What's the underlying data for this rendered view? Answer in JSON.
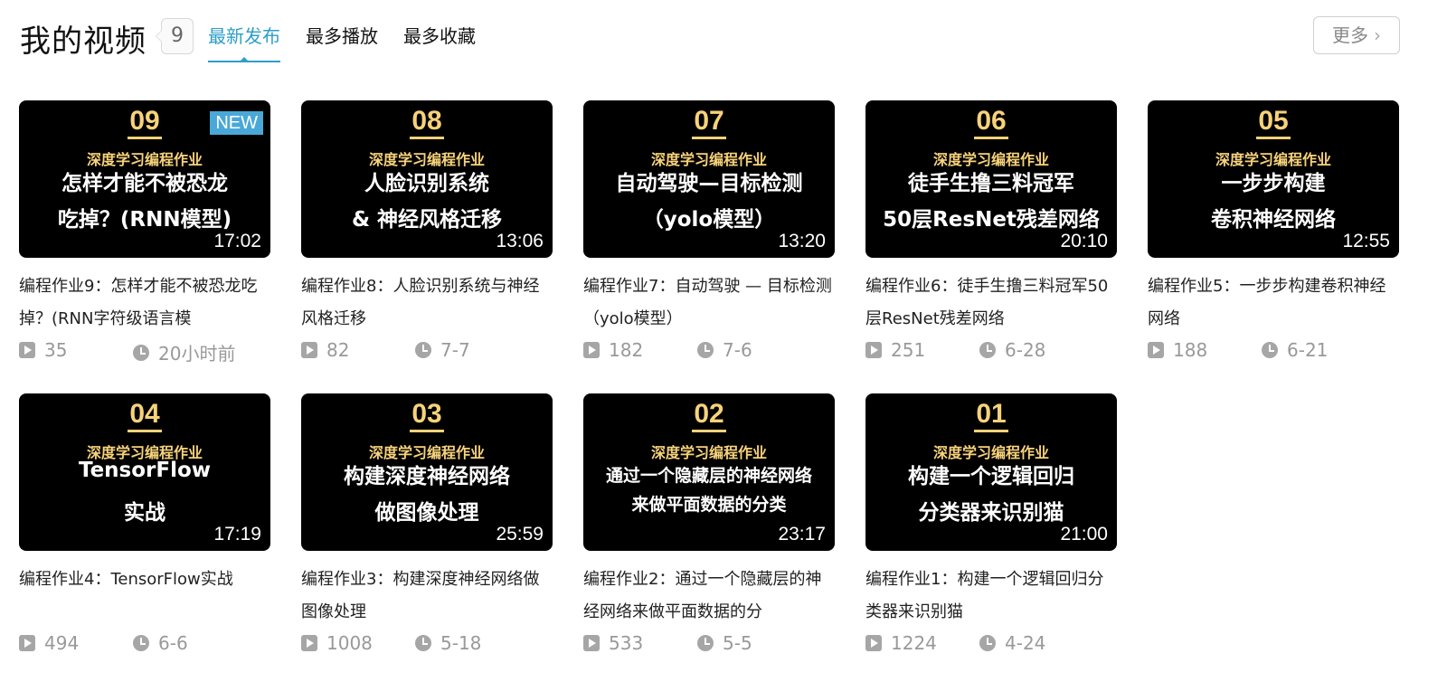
{
  "header": {
    "title": "我的视频",
    "count": "9",
    "tabs": [
      {
        "label": "最新发布"
      },
      {
        "label": "最多播放"
      },
      {
        "label": "最多收藏"
      }
    ],
    "more_label": "更多"
  },
  "icons": {
    "play": "play-icon",
    "clock": "clock-icon",
    "chevron": "chevron-right-icon"
  },
  "colors": {
    "accent": "#2e9ec8",
    "thumb_bg": "#000000",
    "thumb_gold": "#f7d27a",
    "new_badge": "#4aa8d8"
  },
  "videos": [
    {
      "num": "09",
      "category": "深度学习编程作业",
      "lines": [
        "怎样才能不被恐龙",
        "吃掉？(RNN模型)"
      ],
      "duration": "17:02",
      "badge": "NEW",
      "title": "编程作业9：怎样才能不被恐龙吃掉？(RNN字符级语言模",
      "plays": "35",
      "date": "20小时前"
    },
    {
      "num": "08",
      "category": "深度学习编程作业",
      "lines": [
        "人脸识别系统",
        "& 神经风格迁移"
      ],
      "duration": "13:06",
      "title": "编程作业8：人脸识别系统与神经风格迁移",
      "plays": "82",
      "date": "7-7"
    },
    {
      "num": "07",
      "category": "深度学习编程作业",
      "lines": [
        "自动驾驶—目标检测",
        "（yolo模型）"
      ],
      "duration": "13:20",
      "title": "编程作业7：自动驾驶 — 目标检测（yolo模型）",
      "plays": "182",
      "date": "7-6"
    },
    {
      "num": "06",
      "category": "深度学习编程作业",
      "lines": [
        "徒手生撸三料冠军",
        "50层ResNet残差网络"
      ],
      "duration": "20:10",
      "title": "编程作业6：徒手生撸三料冠军50层ResNet残差网络",
      "plays": "251",
      "date": "6-28"
    },
    {
      "num": "05",
      "category": "深度学习编程作业",
      "lines": [
        "一步步构建",
        "卷积神经网络"
      ],
      "duration": "12:55",
      "title": "编程作业5：一步步构建卷积神经网络",
      "plays": "188",
      "date": "6-21"
    },
    {
      "num": "04",
      "category": "深度学习编程作业",
      "lines": [
        "TensorFlow",
        "实战"
      ],
      "duration": "17:19",
      "title": "编程作业4：TensorFlow实战",
      "plays": "494",
      "date": "6-6"
    },
    {
      "num": "03",
      "category": "深度学习编程作业",
      "lines": [
        "构建深度神经网络",
        "做图像处理"
      ],
      "duration": "25:59",
      "title": "编程作业3：构建深度神经网络做图像处理",
      "plays": "1008",
      "date": "5-18"
    },
    {
      "num": "02",
      "category": "深度学习编程作业",
      "lines": [
        "通过一个隐藏层的神经网络",
        "来做平面数据的分类"
      ],
      "duration": "23:17",
      "title": "编程作业2：通过一个隐藏层的神经网络来做平面数据的分",
      "plays": "533",
      "date": "5-5"
    },
    {
      "num": "01",
      "category": "深度学习编程作业",
      "lines": [
        "构建一个逻辑回归",
        "分类器来识别猫"
      ],
      "duration": "21:00",
      "title": "编程作业1：构建一个逻辑回归分类器来识别猫",
      "plays": "1224",
      "date": "4-24"
    }
  ]
}
